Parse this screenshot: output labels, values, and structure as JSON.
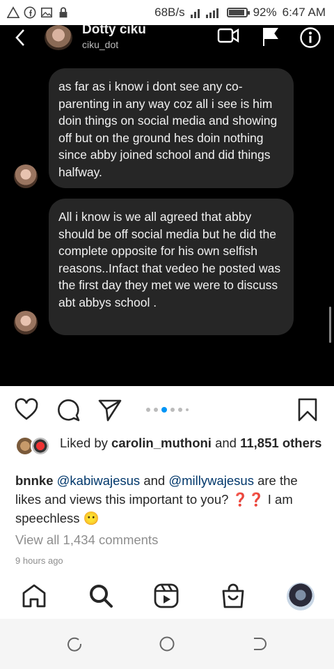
{
  "status_bar": {
    "network_speed": "68B/s",
    "battery_percent": "92%",
    "battery_level": 0.92,
    "time": "6:47 AM",
    "icons": [
      "warning-icon",
      "facebook-icon",
      "image-icon",
      "lock-icon",
      "signal-icon",
      "battery-icon"
    ]
  },
  "dm": {
    "name": "Dotty ciku",
    "username": "ciku_dot",
    "messages": [
      "as far as i know i dont see any co-parenting in any way coz all i see is him doin things on social media and showing off but on the ground hes doin nothing since abby joined school and did things halfway.",
      "All i know is we all agreed that abby should be off social media but he did the complete opposite for his own selfish reasons..Infact that vedeo he posted was the first day they met we were to discuss abt abbys  school ."
    ]
  },
  "post": {
    "likes_prefix": "Liked by ",
    "liked_by_user": "carolin_muthoni",
    "likes_and": " and ",
    "likes_count": "11,851 others",
    "caption_user": "bnnke",
    "mention_1": "@kabiwajesus",
    "caption_and": " and ",
    "mention_2": "@millywajesus",
    "caption_rest": " are the likes and views this important to you? ❓❓ I am speechless 😶",
    "view_all_comments": "View all 1,434 comments",
    "time_ago": "9 hours ago",
    "carousel_active_index": 2
  },
  "colors": {
    "accent": "#0095f6",
    "mention": "#00376b",
    "muted": "#8e8e8e"
  }
}
